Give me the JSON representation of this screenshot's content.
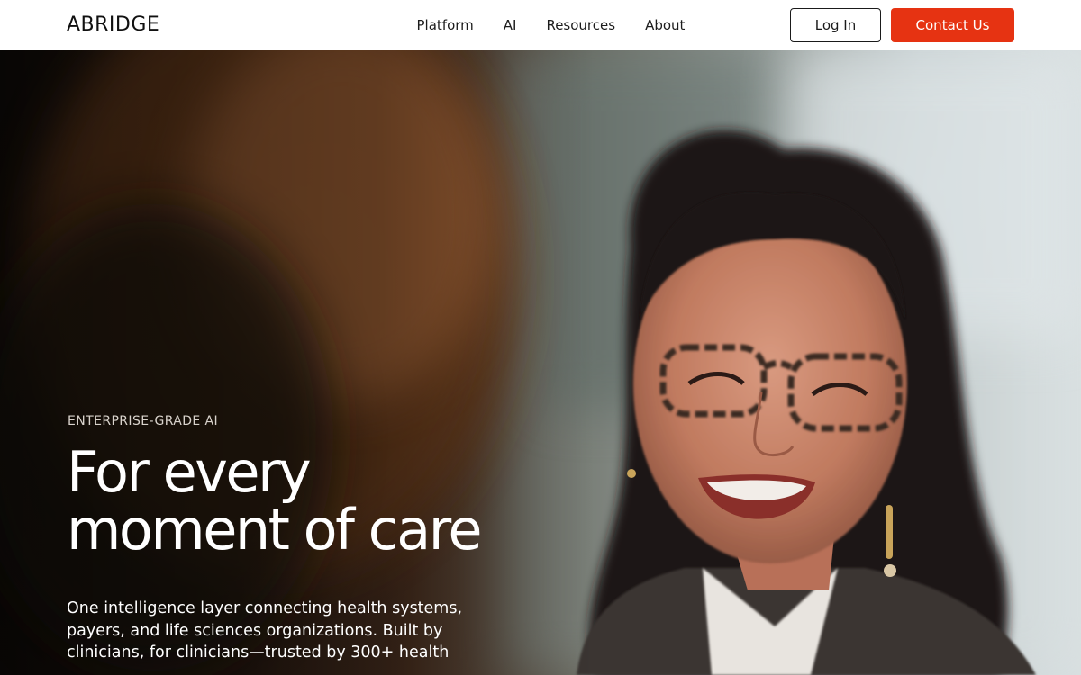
{
  "header": {
    "logo": "ABRIDGE",
    "nav": [
      {
        "label": "Platform"
      },
      {
        "label": "AI"
      },
      {
        "label": "Resources"
      },
      {
        "label": "About"
      }
    ],
    "login_label": "Log In",
    "contact_label": "Contact Us"
  },
  "hero": {
    "eyebrow": "ENTERPRISE-GRADE AI",
    "headline_line1": "For every",
    "headline_line2": "moment of care",
    "subtext": "One intelligence layer connecting health systems, payers, and life sciences organizations. Built by clinicians, for clinicians—trusted by 300+ health"
  },
  "colors": {
    "accent": "#e63312",
    "nav_bg": "#ffffff",
    "text_dark": "#1c1c1c",
    "hero_text": "#ffffff"
  }
}
